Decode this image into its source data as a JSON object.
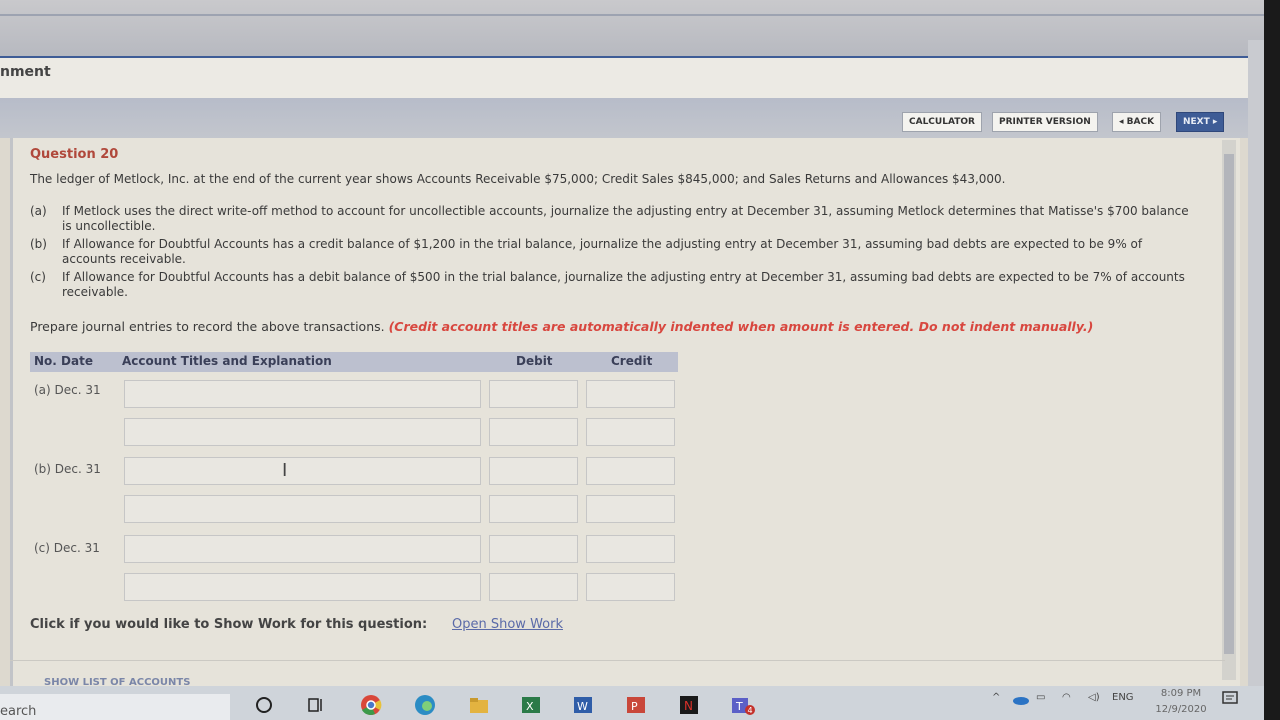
{
  "window": {
    "title_fragment": "nment"
  },
  "toolbar": {
    "calculator": "CALCULATOR",
    "printer": "PRINTER VERSION",
    "back": "◂ BACK",
    "next": "NEXT ▸"
  },
  "question": {
    "title": "Question 20",
    "text": "The ledger of Metlock, Inc. at the end of the current year shows Accounts Receivable $75,000; Credit Sales $845,000; and Sales Returns and Allowances $43,000.",
    "parts": [
      {
        "label": "(a)",
        "text": "If Metlock uses the direct write-off method to account for uncollectible accounts, journalize the adjusting entry at December 31, assuming Metlock determines that Matisse's $700 balance is uncollectible."
      },
      {
        "label": "(b)",
        "text": "If Allowance for Doubtful Accounts has a credit balance of $1,200 in the trial balance, journalize the adjusting entry at December 31, assuming bad debts are expected to be 9% of accounts receivable."
      },
      {
        "label": "(c)",
        "text": "If Allowance for Doubtful Accounts has a debit balance of $500 in the trial balance, journalize the adjusting entry at December 31, assuming bad debts are expected to be 7% of accounts receivable."
      }
    ],
    "instruction": "Prepare journal entries to record the above transactions.",
    "instruction_note": "(Credit account titles are automatically indented when amount is entered. Do not indent manually.)"
  },
  "journal": {
    "headers": {
      "no_date": "No. Date",
      "account": "Account Titles and Explanation",
      "debit": "Debit",
      "credit": "Credit"
    },
    "entries": [
      {
        "label": "(a)  Dec. 31"
      },
      {
        "label": "(b)  Dec. 31"
      },
      {
        "label": "(c)  Dec. 31"
      }
    ]
  },
  "show_work": {
    "prompt": "Click if you would like to Show Work for this question:",
    "link": "Open Show Work"
  },
  "footer": {
    "show_list": "SHOW LIST OF ACCOUNTS"
  },
  "taskbar": {
    "search_fragment": "earch",
    "lang": "ENG",
    "time": "8:09 PM",
    "date": "12/9/2020",
    "icons": [
      "cortana-icon",
      "task-view-icon",
      "chrome-icon",
      "edge-icon",
      "explorer-icon",
      "excel-icon",
      "word-icon",
      "powerpoint-icon",
      "netflix-icon",
      "teams-icon"
    ],
    "teams_badge": "4"
  }
}
